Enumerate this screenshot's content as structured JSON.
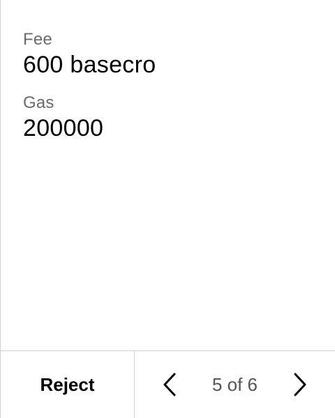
{
  "fields": [
    {
      "label": "Fee",
      "value": "600 basecro"
    },
    {
      "label": "Gas",
      "value": "200000"
    }
  ],
  "footer": {
    "reject_label": "Reject",
    "page_indicator": "5 of 6",
    "prev_icon": "chevron-left-icon",
    "next_icon": "chevron-right-icon"
  },
  "colors": {
    "label": "#6b6b6b",
    "value": "#000000",
    "border": "#cfcfcf",
    "indicator": "#555555"
  }
}
